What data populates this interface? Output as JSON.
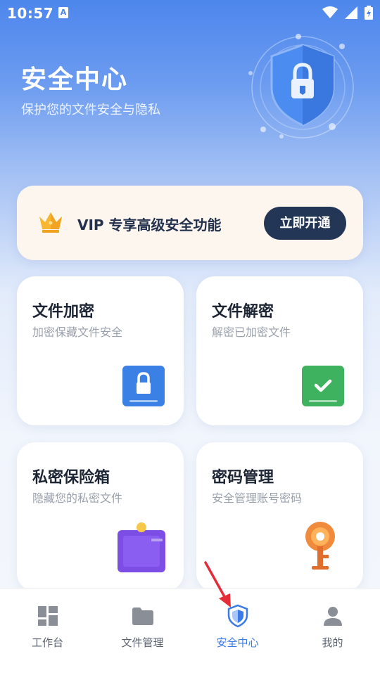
{
  "status_bar": {
    "time": "10:57",
    "notification_badge": "A",
    "icons": [
      "wifi-icon",
      "signal-icon",
      "battery-icon"
    ]
  },
  "hero": {
    "title": "安全中心",
    "subtitle": "保护您的文件安全与隐私",
    "illustration": "shield-lock-icon"
  },
  "vip": {
    "text": "VIP 专享高级安全功能",
    "button_label": "立即开通",
    "icon": "crown-icon"
  },
  "cards": [
    {
      "title": "文件加密",
      "desc": "加密保藏文件安全",
      "icon": "lock-icon",
      "color": "#3b80e4"
    },
    {
      "title": "文件解密",
      "desc": "解密已加密文件",
      "icon": "check-icon",
      "color": "#3fb25f"
    },
    {
      "title": "私密保险箱",
      "desc": "隐藏您的私密文件",
      "icon": "safe-box-icon",
      "color": "#7c4ee6"
    },
    {
      "title": "密码管理",
      "desc": "安全管理账号密码",
      "icon": "key-icon",
      "color": "#f08a3c"
    }
  ],
  "bottom_nav": {
    "items": [
      {
        "label": "工作台",
        "icon": "dashboard-icon",
        "active": false
      },
      {
        "label": "文件管理",
        "icon": "folder-icon",
        "active": false
      },
      {
        "label": "安全中心",
        "icon": "shield-icon",
        "active": true
      },
      {
        "label": "我的",
        "icon": "person-icon",
        "active": false
      }
    ]
  },
  "colors": {
    "accent": "#3b7be8",
    "dark_button": "#243656",
    "vip_background": "#fdf6ef"
  }
}
